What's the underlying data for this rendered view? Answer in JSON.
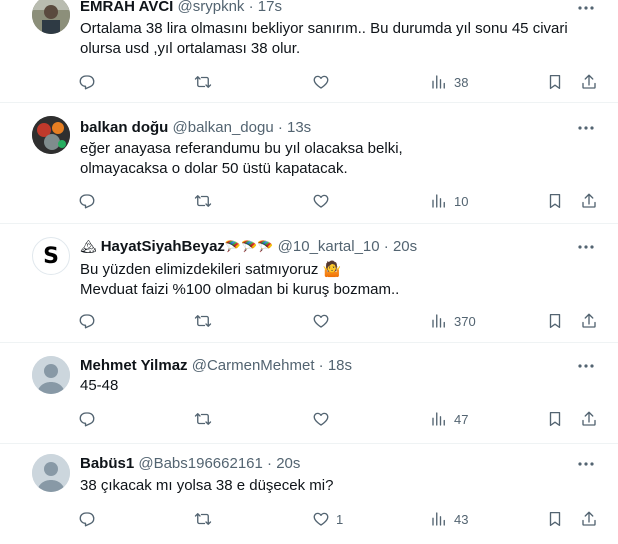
{
  "tweets": [
    {
      "name": "EMRAH AVCI",
      "handle": "@srypknk",
      "dot": "·",
      "time": "17s",
      "text": "Ortalama 38 lira olmasını bekliyor sanırım.. Bu durumda yıl sonu 45 civari\nolursa usd ,yıl ortalaması 38 olur.",
      "views": "38",
      "likes": "",
      "avatar": "photo-man-outdoor"
    },
    {
      "name": "balkan doğu",
      "handle": "@balkan_dogu",
      "dot": "·",
      "time": "13s",
      "text": "eğer anayasa referandumu bu yıl olacaksa belki,\nolmayacaksa o dolar 50 üstü kapatacak.",
      "views": "10",
      "likes": "",
      "avatar": "photo-colorful"
    },
    {
      "name": "HayatSiyahBeyaz",
      "handle": "@10_kartal_10",
      "dot": "·",
      "time": "20s",
      "text": "Bu yüzden elimizdekileri satmıyoruz 🤷\nMevduat faizi %100 olmadan bi kuruş bozmam..",
      "views": "370",
      "likes": "",
      "avatar": "letter-s-logo",
      "avatar_letter": "S",
      "name_prefix_emoji": "🏔",
      "name_suffix_emoji": "🪂🪂🪂"
    },
    {
      "name": "Mehmet Yilmaz",
      "handle": "@CarmenMehmet",
      "dot": "·",
      "time": "18s",
      "text": "45-48",
      "views": "47",
      "likes": "",
      "avatar": "default-avatar"
    },
    {
      "name": "Babüs1",
      "handle": "@Babs196662161",
      "dot": "·",
      "time": "20s",
      "text": "38 çıkacak mı yolsa 38 e düşecek mi?",
      "views": "43",
      "likes": "1",
      "avatar": "default-avatar"
    }
  ],
  "icons": {
    "reply": "reply-icon",
    "retweet": "retweet-icon",
    "like": "like-icon",
    "views": "views-icon",
    "bookmark": "bookmark-icon",
    "share": "share-icon",
    "more": "more-icon"
  },
  "colors": {
    "text": "#0f1419",
    "secondary": "#536471",
    "divider": "#eff3f4"
  }
}
